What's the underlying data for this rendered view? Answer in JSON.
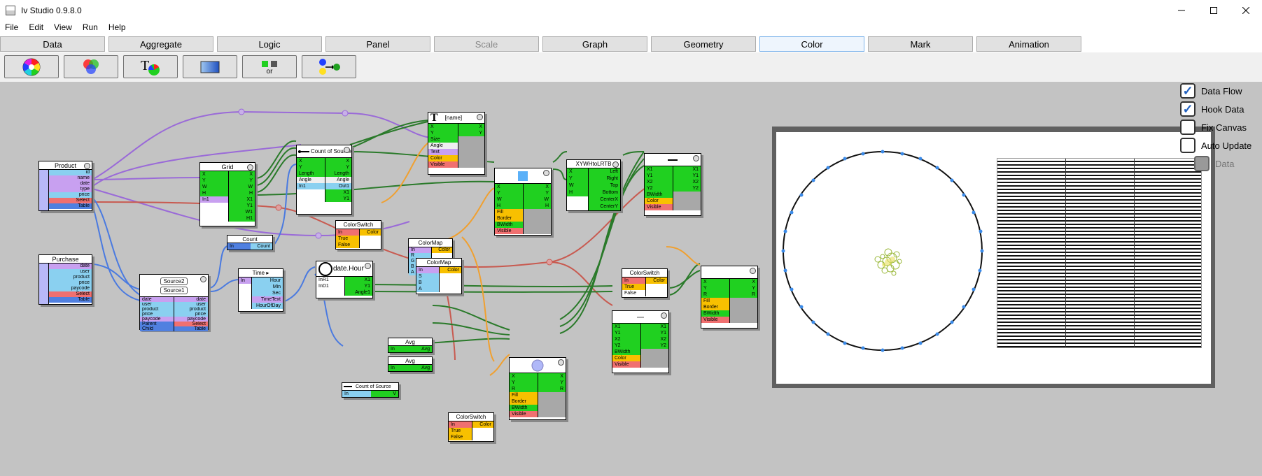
{
  "window": {
    "title": "Iv Studio 0.9.8.0"
  },
  "menu": [
    "File",
    "Edit",
    "View",
    "Run",
    "Help"
  ],
  "tabs": [
    {
      "label": "Data",
      "state": "normal"
    },
    {
      "label": "Aggregate",
      "state": "normal"
    },
    {
      "label": "Logic",
      "state": "normal"
    },
    {
      "label": "Panel",
      "state": "normal"
    },
    {
      "label": "Scale",
      "state": "disabled"
    },
    {
      "label": "Graph",
      "state": "normal"
    },
    {
      "label": "Geometry",
      "state": "normal"
    },
    {
      "label": "Color",
      "state": "active"
    },
    {
      "label": "Mark",
      "state": "normal"
    },
    {
      "label": "Animation",
      "state": "normal"
    }
  ],
  "toolbar": {
    "buttons": [
      "color-wheel-icon",
      "rgb-circles-icon",
      "text-color-icon",
      "gradient-rect-icon",
      "color-switch-icon",
      "color-map-icon"
    ],
    "text_glyph": "T",
    "or_label": "or"
  },
  "options": [
    {
      "label": "Data Flow",
      "checked": true,
      "enabled": true
    },
    {
      "label": "Hook Data",
      "checked": true,
      "enabled": true
    },
    {
      "label": "Fix Canvas",
      "checked": false,
      "enabled": true
    },
    {
      "label": "Auto Update",
      "checked": false,
      "enabled": true
    },
    {
      "label": "Data",
      "checked": false,
      "enabled": false
    }
  ],
  "nodes": {
    "product": {
      "title": "Product",
      "ports": [
        "id",
        "name",
        "date",
        "type",
        "price",
        "Select",
        "Table"
      ]
    },
    "purchase": {
      "title": "Purchase",
      "ports": [
        "date",
        "user",
        "product",
        "price",
        "paycode",
        "Select",
        "Table"
      ]
    },
    "grid": {
      "title": "Grid",
      "in": [
        "X",
        "Y",
        "W",
        "H",
        "In1"
      ],
      "out": [
        "X",
        "Y",
        "W",
        "H",
        "X1",
        "Y1",
        "W1",
        "H1"
      ]
    },
    "count_source_1": {
      "title": "Count of Source",
      "in": [
        "X",
        "Y",
        "Length",
        "Angle",
        "In1"
      ],
      "out": [
        "X",
        "Y",
        "Length",
        "Angle",
        "Out1",
        "X1",
        "Y1"
      ]
    },
    "text_node": {
      "title": "[name]",
      "glyph": "T",
      "in": [
        "X",
        "Y",
        "Size",
        "Angle",
        "Text",
        "Color",
        "Visible"
      ],
      "out": [
        "X",
        "Y"
      ]
    },
    "rect_node": {
      "in": [
        "X",
        "Y",
        "W",
        "H",
        "Fill",
        "Border",
        "BWidth",
        "Visible"
      ],
      "out": [
        "X",
        "Y",
        "W",
        "H"
      ]
    },
    "xywh": {
      "title": "XYWHtoLRTB",
      "in": [
        "X",
        "Y",
        "W",
        "H"
      ],
      "out": [
        "Left",
        "Right",
        "Top",
        "Bottom",
        "CenterX",
        "CenterY"
      ]
    },
    "line_node": {
      "in": [
        "X1",
        "Y1",
        "X2",
        "Y2",
        "BWidth",
        "Color",
        "Visible"
      ],
      "out": [
        "X1",
        "Y1",
        "X2",
        "Y2"
      ]
    },
    "colorswitch_1": {
      "title": "ColorSwitch",
      "in": [
        "In",
        "True",
        "False"
      ],
      "out": [
        "Color"
      ]
    },
    "colormap_1": {
      "title": "ColorMap",
      "in": [
        "In",
        "R",
        "G",
        "B",
        "A"
      ],
      "out": [
        "Color"
      ]
    },
    "colormap_2": {
      "title": "ColorMap",
      "in": [
        "In",
        "S",
        "B",
        "A"
      ],
      "out": [
        "Color"
      ]
    },
    "source": {
      "titles": [
        "Source2",
        "Source1"
      ],
      "ports": [
        "date",
        "user",
        "product",
        "price",
        "paycode",
        "Parent",
        "Child"
      ],
      "out": [
        "date",
        "user",
        "product",
        "price",
        "paycode",
        "Select",
        "Table"
      ]
    },
    "count_node": {
      "title": "Count",
      "in": [
        "In"
      ],
      "out": [
        "Count"
      ]
    },
    "time_node": {
      "title": "Time ▸",
      "in": [
        "In"
      ],
      "out": [
        "Hour",
        "Min",
        "Sec",
        "TimeText",
        "HourOfDay"
      ]
    },
    "date_hour": {
      "title": "date.Hour",
      "in": [
        "InR1",
        "InD1"
      ],
      "out": [
        "X1",
        "Y1",
        "Angle1"
      ]
    },
    "avg_1": {
      "title": "Avg",
      "in": [
        "In"
      ],
      "out": [
        "Avg"
      ]
    },
    "avg_2": {
      "title": "Avg",
      "in": [
        "In"
      ],
      "out": [
        "Avg"
      ]
    },
    "count_source_2": {
      "title": "Count of Source",
      "in": [
        "In"
      ],
      "out": [
        "V"
      ]
    },
    "circle_node": {
      "in": [
        "X",
        "Y",
        "R",
        "Fill",
        "Border",
        "BWidth",
        "Visible"
      ],
      "out": [
        "X",
        "Y",
        "R"
      ]
    },
    "colorswitch_2": {
      "title": "ColorSwitch",
      "in": [
        "In",
        "True",
        "False"
      ],
      "out": [
        "Color"
      ]
    },
    "colorswitch_3": {
      "title": "ColorSwitch",
      "in": [
        "In",
        "True",
        "False"
      ],
      "out": [
        "Color"
      ]
    },
    "line_node_2": {
      "in": [
        "X1",
        "Y1",
        "X2",
        "Y2",
        "BWidth",
        "Color",
        "Visible"
      ],
      "out": [
        "X1",
        "Y1",
        "X2",
        "Y2"
      ]
    },
    "circle_node_2": {
      "in": [
        "X",
        "Y",
        "R",
        "Fill",
        "Border",
        "BWidth",
        "Visible"
      ],
      "out": [
        "X",
        "Y",
        "R"
      ]
    }
  },
  "colors": {
    "canvas_bg": "#c3c3c3",
    "wire_violet": "#9a6ad8",
    "wire_green": "#2a7a2a",
    "wire_red": "#c85a50",
    "wire_orange": "#f0a030",
    "wire_blue": "#4a7ae0",
    "accent": "#0078d7"
  }
}
